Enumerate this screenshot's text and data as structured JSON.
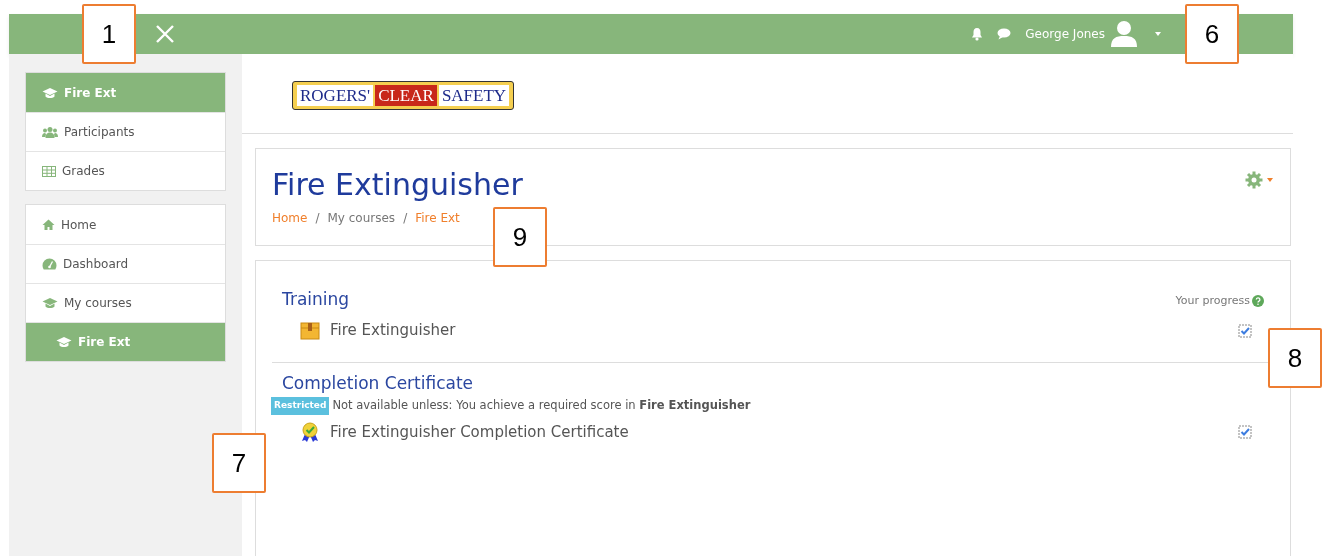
{
  "navbar": {
    "user_name": "George Jones"
  },
  "sidebar": {
    "groups": [
      {
        "items": [
          {
            "label": "Fire Ext",
            "selected": true
          },
          {
            "label": "Participants",
            "selected": false
          },
          {
            "label": "Grades",
            "selected": false
          }
        ]
      },
      {
        "items": [
          {
            "label": "Home",
            "selected": false
          },
          {
            "label": "Dashboard",
            "selected": false
          },
          {
            "label": "My courses",
            "selected": false,
            "children": [
              {
                "label": "Fire Ext",
                "selected": true
              }
            ]
          }
        ]
      }
    ]
  },
  "logo": {
    "parts": [
      "ROGERS'",
      "CLEAR",
      "SAFETY"
    ]
  },
  "header": {
    "title": "Fire Extinguisher",
    "breadcrumb_separator": "/",
    "breadcrumb": [
      {
        "label": "Home",
        "link": true
      },
      {
        "label": "My courses",
        "link": false
      },
      {
        "label": "Fire Ext",
        "link": true
      }
    ]
  },
  "progress_label": "Your progress",
  "sections": [
    {
      "title": "Training",
      "activities": [
        {
          "kind": "scorm",
          "label": "Fire Extinguisher",
          "completed": true
        }
      ]
    },
    {
      "title": "Completion Certificate",
      "restriction": {
        "badge": "Restricted",
        "text": "Not available unless: You achieve a required score in **Fire Extinguisher**"
      },
      "activities": [
        {
          "kind": "certificate",
          "label": "Fire Extinguisher Completion Certificate",
          "completed": true
        }
      ]
    }
  ],
  "callouts": [
    {
      "number": "1"
    },
    {
      "number": "6"
    },
    {
      "number": "9"
    },
    {
      "number": "8"
    },
    {
      "number": "7"
    }
  ]
}
